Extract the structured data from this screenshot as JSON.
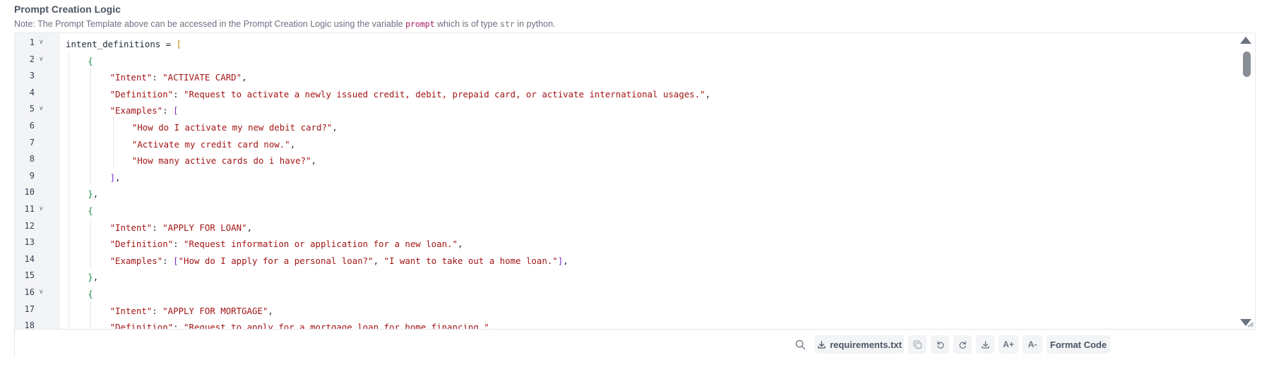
{
  "header": {
    "title": "Prompt Creation Logic",
    "note_before": "Note: The Prompt Template above can be accessed in the Prompt Creation Logic using the variable",
    "note_var": "prompt",
    "note_middle": "which is of type",
    "note_type": "str",
    "note_after": "in python."
  },
  "editor": {
    "lines": [
      {
        "n": "1",
        "fold": true,
        "indent": 0,
        "tokens": [
          [
            "p",
            "intent_definitions = "
          ],
          [
            "b1",
            "["
          ]
        ]
      },
      {
        "n": "2",
        "fold": true,
        "indent": 1,
        "tokens": [
          [
            "b2",
            "{"
          ]
        ]
      },
      {
        "n": "3",
        "fold": false,
        "indent": 2,
        "tokens": [
          [
            "s",
            "\"Intent\""
          ],
          [
            "p",
            ": "
          ],
          [
            "s",
            "\"ACTIVATE CARD\""
          ],
          [
            "p",
            ","
          ]
        ]
      },
      {
        "n": "4",
        "fold": false,
        "indent": 2,
        "tokens": [
          [
            "s",
            "\"Definition\""
          ],
          [
            "p",
            ": "
          ],
          [
            "s",
            "\"Request to activate a newly issued credit, debit, prepaid card, or activate international usages.\""
          ],
          [
            "p",
            ","
          ]
        ]
      },
      {
        "n": "5",
        "fold": true,
        "indent": 2,
        "tokens": [
          [
            "s",
            "\"Examples\""
          ],
          [
            "p",
            ": "
          ],
          [
            "b3",
            "["
          ]
        ]
      },
      {
        "n": "6",
        "fold": false,
        "indent": 3,
        "tokens": [
          [
            "s",
            "\"How do I activate my new debit card?\""
          ],
          [
            "p",
            ","
          ]
        ]
      },
      {
        "n": "7",
        "fold": false,
        "indent": 3,
        "tokens": [
          [
            "s",
            "\"Activate my credit card now.\""
          ],
          [
            "p",
            ","
          ]
        ]
      },
      {
        "n": "8",
        "fold": false,
        "indent": 3,
        "tokens": [
          [
            "s",
            "\"How many active cards do i have?\""
          ],
          [
            "p",
            ","
          ]
        ]
      },
      {
        "n": "9",
        "fold": false,
        "indent": 2,
        "tokens": [
          [
            "b3",
            "]"
          ],
          [
            "p",
            ","
          ]
        ]
      },
      {
        "n": "10",
        "fold": false,
        "indent": 1,
        "tokens": [
          [
            "b2",
            "}"
          ],
          [
            "p",
            ","
          ]
        ]
      },
      {
        "n": "11",
        "fold": true,
        "indent": 1,
        "tokens": [
          [
            "b2",
            "{"
          ]
        ]
      },
      {
        "n": "12",
        "fold": false,
        "indent": 2,
        "tokens": [
          [
            "s",
            "\"Intent\""
          ],
          [
            "p",
            ": "
          ],
          [
            "s",
            "\"APPLY FOR LOAN\""
          ],
          [
            "p",
            ","
          ]
        ]
      },
      {
        "n": "13",
        "fold": false,
        "indent": 2,
        "tokens": [
          [
            "s",
            "\"Definition\""
          ],
          [
            "p",
            ": "
          ],
          [
            "s",
            "\"Request information or application for a new loan.\""
          ],
          [
            "p",
            ","
          ]
        ]
      },
      {
        "n": "14",
        "fold": false,
        "indent": 2,
        "tokens": [
          [
            "s",
            "\"Examples\""
          ],
          [
            "p",
            ": "
          ],
          [
            "b3",
            "["
          ],
          [
            "s",
            "\"How do I apply for a personal loan?\""
          ],
          [
            "p",
            ", "
          ],
          [
            "s",
            "\"I want to take out a home loan.\""
          ],
          [
            "b3",
            "]"
          ],
          [
            "p",
            ","
          ]
        ]
      },
      {
        "n": "15",
        "fold": false,
        "indent": 1,
        "tokens": [
          [
            "b2",
            "}"
          ],
          [
            "p",
            ","
          ]
        ]
      },
      {
        "n": "16",
        "fold": true,
        "indent": 1,
        "tokens": [
          [
            "b2",
            "{"
          ]
        ]
      },
      {
        "n": "17",
        "fold": false,
        "indent": 2,
        "tokens": [
          [
            "s",
            "\"Intent\""
          ],
          [
            "p",
            ": "
          ],
          [
            "s",
            "\"APPLY FOR MORTGAGE\""
          ],
          [
            "p",
            ","
          ]
        ]
      },
      {
        "n": "18",
        "fold": false,
        "indent": 2,
        "tokens": [
          [
            "s",
            "\"Definition\""
          ],
          [
            "p",
            ": "
          ],
          [
            "s",
            "\"Request to apply for a mortgage loan for home financing.\""
          ],
          [
            "p",
            ","
          ]
        ]
      }
    ]
  },
  "toolbar": {
    "requirements_label": "requirements.txt",
    "font_increase_label": "A+",
    "font_decrease_label": "A-",
    "format_label": "Format Code"
  }
}
